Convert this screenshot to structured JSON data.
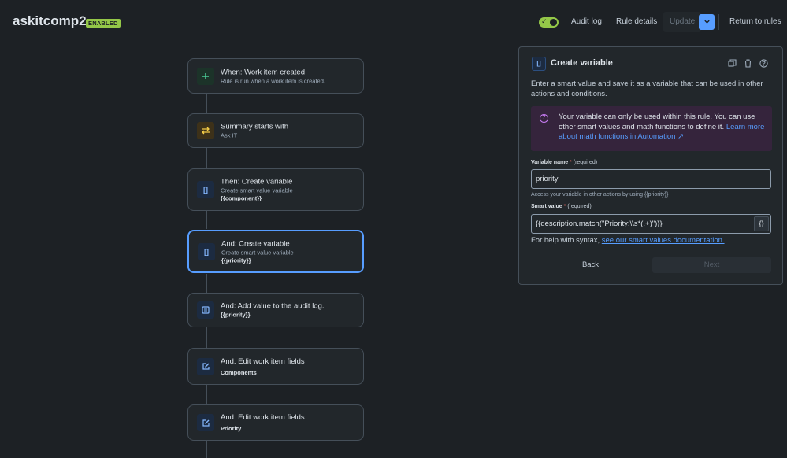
{
  "header": {
    "rule_name": "askitcomp2",
    "status_badge": "ENABLED",
    "audit_log": "Audit log",
    "rule_details": "Rule details",
    "update": "Update",
    "return_to_rules": "Return to rules"
  },
  "flow": {
    "steps": [
      {
        "type": "trigger",
        "icon": "plus-icon",
        "title": "When: Work item created",
        "subtitle": "Rule is run when a work item is created.",
        "detail": ""
      },
      {
        "type": "condition",
        "icon": "swap-arrows-icon",
        "title": "Summary starts with",
        "subtitle": "Ask IT",
        "detail": ""
      },
      {
        "type": "action",
        "icon": "braces-icon",
        "title": "Then: Create variable",
        "subtitle": "Create smart value variable",
        "detail": "{{component}}"
      },
      {
        "type": "action",
        "icon": "braces-icon",
        "title": "And: Create variable",
        "subtitle": "Create smart value variable",
        "detail": "{{priority}}",
        "selected": true
      },
      {
        "type": "action",
        "icon": "log-icon",
        "title": "And: Add value to the audit log.",
        "subtitle": "",
        "detail": "{{priority}}"
      },
      {
        "type": "action",
        "icon": "edit-icon",
        "title": "And: Edit work item fields",
        "subtitle": "",
        "detail": "Components"
      },
      {
        "type": "action",
        "icon": "edit-icon",
        "title": "And: Edit work item fields",
        "subtitle": "",
        "detail": "Priority"
      }
    ]
  },
  "panel": {
    "icon": "braces-icon",
    "title": "Create variable",
    "description": "Enter a smart value and save it as a variable that can be used in other actions and conditions.",
    "info": {
      "text": "Your variable can only be used within this rule. You can use other smart values and math functions to define it. ",
      "link": "Learn more about math functions in Automation ↗"
    },
    "variable_name": {
      "label": "Variable name",
      "required": "*",
      "required_text": "(required)",
      "value": "priority",
      "helper": "Access your variable in other actions by using {{priority}}"
    },
    "smart_value": {
      "label": "Smart value",
      "required": "*",
      "required_text": "(required)",
      "value": "{{description.match(\"Priority:\\\\s*(.+)\")}}",
      "button": "{}"
    },
    "syntax_help": "For help with syntax,",
    "syntax_link": "see our smart values documentation.",
    "back": "Back",
    "next": "Next"
  },
  "colors": {
    "accent": "#579dff",
    "enabled": "#94c748",
    "background": "#1d2125"
  }
}
